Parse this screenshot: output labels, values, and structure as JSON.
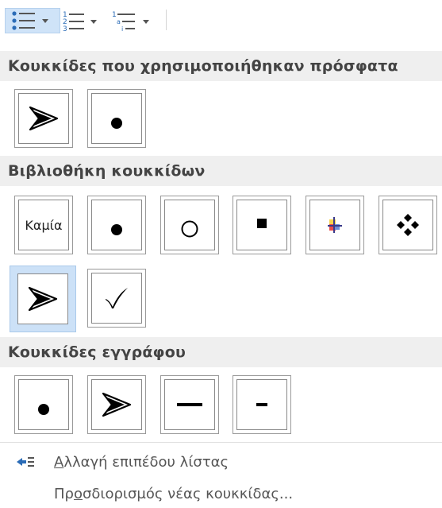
{
  "toolbar": {
    "buttons": [
      {
        "name": "bullets-button",
        "active": true
      },
      {
        "name": "numbering-button",
        "active": false
      },
      {
        "name": "multilevel-list-button",
        "active": false
      }
    ]
  },
  "sections": {
    "recent": {
      "title": "Κουκκίδες που χρησιμοποιήθηκαν πρόσφατα"
    },
    "library": {
      "title": "Βιβλιοθήκη κουκκίδων",
      "none_label": "Καμία"
    },
    "document": {
      "title": "Κουκκίδες εγγράφου"
    }
  },
  "menu": {
    "change_level": {
      "accel": "Α",
      "rest": "λλαγή επιπέδου λίστας"
    },
    "define_new": {
      "pre": "Πρ",
      "accel": "ο",
      "rest": "σδιορισμός νέας κουκκίδας..."
    }
  },
  "colors": {
    "selected_bg": "#cce1f7",
    "header_bg": "#efefef",
    "toolbar_active_bg": "#cfe3f8",
    "accent_blue": "#2b6cb7"
  }
}
